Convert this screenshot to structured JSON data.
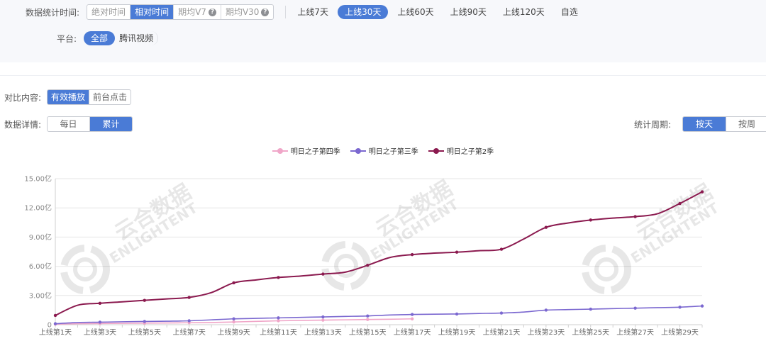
{
  "filters": {
    "time_label": "数据统计时间:",
    "time_modes": [
      "绝对时间",
      "相对时间",
      "期均V7",
      "期均V30"
    ],
    "time_mode_active": 1,
    "quick_ranges": [
      "上线7天",
      "上线30天",
      "上线60天",
      "上线90天",
      "上线120天",
      "自选"
    ],
    "quick_range_active": 1,
    "platform_label": "平台:",
    "platforms": [
      "全部",
      "腾讯视频"
    ],
    "platform_active": 0
  },
  "compare": {
    "label": "对比内容:",
    "options": [
      "有效播放",
      "前台点击"
    ],
    "active": 0
  },
  "detail": {
    "label": "数据详情:",
    "options": [
      "每日",
      "累计"
    ],
    "active": 1
  },
  "period": {
    "label": "统计周期:",
    "options": [
      "按天",
      "按周"
    ],
    "active": 0
  },
  "watermark": {
    "cn": "云合数据",
    "en": "ENLIGHTENT"
  },
  "chart_data": {
    "type": "line",
    "x_labels_shown": [
      "上线第1天",
      "上线第3天",
      "上线第5天",
      "上线第7天",
      "上线第9天",
      "上线第11天",
      "上线第13天",
      "上线第15天",
      "上线第17天",
      "上线第19天",
      "上线第21天",
      "上线第23天",
      "上线第25天",
      "上线第27天",
      "上线第29天"
    ],
    "x": [
      1,
      2,
      3,
      4,
      5,
      6,
      7,
      8,
      9,
      10,
      11,
      12,
      13,
      14,
      15,
      16,
      17,
      18,
      19,
      20,
      21,
      22,
      23,
      24,
      25,
      26,
      27,
      28,
      29,
      30
    ],
    "y_ticks": [
      "0",
      "3.00亿",
      "6.00亿",
      "9.00亿",
      "12.00亿",
      "15.00亿"
    ],
    "ylim": [
      0,
      15
    ],
    "grid": true,
    "legend_position": "top-center",
    "series": [
      {
        "name": "明日之子第四季",
        "color": "#f0a6c8",
        "values": [
          0.05,
          0.1,
          0.12,
          0.14,
          0.16,
          0.18,
          0.2,
          0.22,
          0.28,
          0.34,
          0.4,
          0.44,
          0.47,
          0.5,
          0.53,
          0.56,
          0.6
        ]
      },
      {
        "name": "明日之子第三季",
        "color": "#7b68d0",
        "values": [
          0.1,
          0.22,
          0.26,
          0.3,
          0.33,
          0.36,
          0.4,
          0.5,
          0.6,
          0.65,
          0.7,
          0.75,
          0.8,
          0.85,
          0.9,
          1.0,
          1.05,
          1.08,
          1.1,
          1.15,
          1.2,
          1.3,
          1.5,
          1.55,
          1.6,
          1.65,
          1.7,
          1.75,
          1.8,
          1.92
        ]
      },
      {
        "name": "明日之子第2季",
        "color": "#8b1a4f",
        "values": [
          0.95,
          2.0,
          2.2,
          2.35,
          2.5,
          2.65,
          2.8,
          3.3,
          4.3,
          4.6,
          4.85,
          5.0,
          5.2,
          5.4,
          6.1,
          6.9,
          7.2,
          7.35,
          7.45,
          7.6,
          7.75,
          8.8,
          10.0,
          10.45,
          10.75,
          10.95,
          11.1,
          11.4,
          12.45,
          13.65
        ]
      }
    ]
  }
}
